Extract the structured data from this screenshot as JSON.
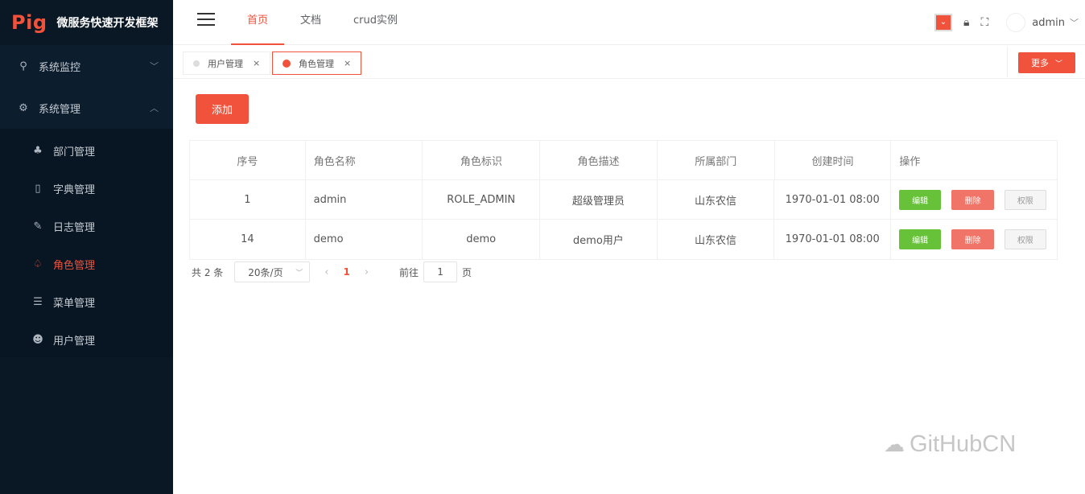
{
  "app": {
    "brand": "Pig",
    "subtitle": "微服务快速开发框架"
  },
  "sidebar": {
    "groups": [
      {
        "label": "系统监控",
        "icon": "monitor-icon",
        "chevron": "﹀"
      },
      {
        "label": "系统管理",
        "icon": "settings-icon",
        "chevron": "︿"
      }
    ],
    "items": [
      {
        "label": "部门管理",
        "icon": "org-icon"
      },
      {
        "label": "字典管理",
        "icon": "dict-icon"
      },
      {
        "label": "日志管理",
        "icon": "log-icon"
      },
      {
        "label": "角色管理",
        "icon": "role-icon",
        "active": true
      },
      {
        "label": "菜单管理",
        "icon": "menu-icon"
      },
      {
        "label": "用户管理",
        "icon": "user-icon"
      }
    ]
  },
  "topnav": {
    "tabs": [
      "首页",
      "文档",
      "crud实例"
    ],
    "active": "首页"
  },
  "user": {
    "name": "admin"
  },
  "tags": [
    {
      "label": "用户管理",
      "close": "×"
    },
    {
      "label": "角色管理",
      "close": "×",
      "active": true
    }
  ],
  "more_label": "更多",
  "add_label": "添加",
  "table": {
    "headers": [
      "序号",
      "角色名称",
      "角色标识",
      "角色描述",
      "所属部门",
      "创建时间",
      "操作"
    ],
    "rows": [
      {
        "idx": "1",
        "name": "admin",
        "code": "ROLE_ADMIN",
        "desc": "超级管理员",
        "dept": "山东农信",
        "time": "1970-01-01 08:00"
      },
      {
        "idx": "14",
        "name": "demo",
        "code": "demo",
        "desc": "demo用户",
        "dept": "山东农信",
        "time": "1970-01-01 08:00"
      }
    ],
    "ops": {
      "edit": "编辑",
      "delete": "删除",
      "perm": "权限"
    }
  },
  "pager": {
    "total": "共 2 条",
    "page_size": "20条/页",
    "current": "1",
    "goto": "前往",
    "goto_value": "1",
    "page_suffix": "页"
  },
  "watermark": "GitHubCN",
  "colors": {
    "accent": "#f0523b",
    "sidebar": "#0b1b2b",
    "edit": "#67c23a",
    "delete": "#f07468"
  }
}
